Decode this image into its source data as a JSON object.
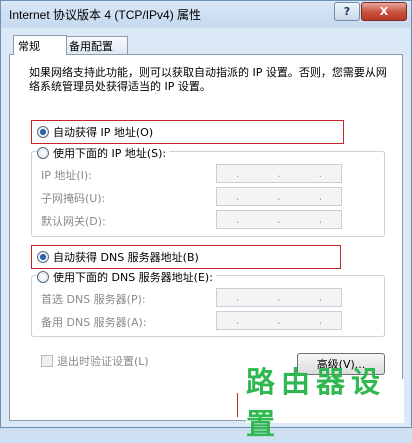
{
  "window": {
    "title": "Internet 协议版本 4 (TCP/IPv4) 属性",
    "help_glyph": "?",
    "close_glyph": "X"
  },
  "tabs": [
    {
      "label": "常规"
    },
    {
      "label": "备用配置"
    }
  ],
  "description": "如果网络支持此功能，则可以获取自动指派的 IP 设置。否则，您需要从网络系统管理员处获得适当的 IP 设置。",
  "ip": {
    "auto_label": "自动获得 IP 地址(O)",
    "manual_label": "使用下面的 IP 地址(S):",
    "fields": [
      {
        "label": "IP 地址(I):"
      },
      {
        "label": "子网掩码(U):"
      },
      {
        "label": "默认网关(D):"
      }
    ]
  },
  "dns": {
    "auto_label": "自动获得 DNS 服务器地址(B)",
    "manual_label": "使用下面的 DNS 服务器地址(E):",
    "fields": [
      {
        "label": "首选 DNS 服务器(P):"
      },
      {
        "label": "备用 DNS 服务器(A):"
      }
    ]
  },
  "ip_dot": ".",
  "validate_label": "退出时验证设置(L)",
  "advanced_label": "高级(V)...",
  "watermark": "路由器设置",
  "colors": {
    "highlight": "#c2252c",
    "watermark": "#2eb84f"
  }
}
